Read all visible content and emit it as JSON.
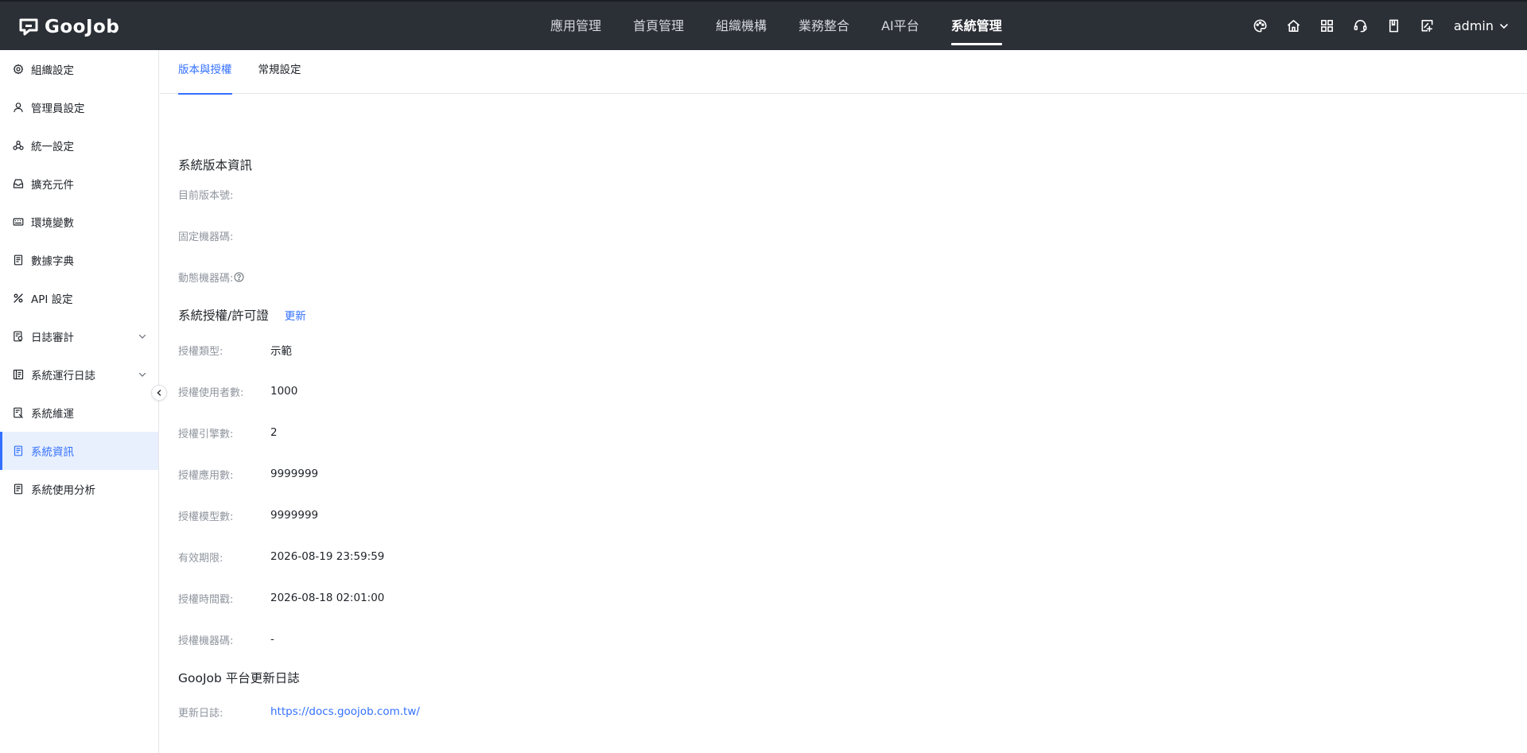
{
  "app": {
    "logo_text": "GooJob",
    "colors": {
      "topbar": "#2b2f36",
      "accent": "#3370ff",
      "active_bg": "#e8f0fe"
    }
  },
  "topnav": {
    "items": [
      {
        "label": "應用管理"
      },
      {
        "label": "首頁管理"
      },
      {
        "label": "組織機構"
      },
      {
        "label": "業務整合"
      },
      {
        "label": "AI平台"
      },
      {
        "label": "系統管理",
        "active": true
      }
    ],
    "icons": [
      "palette-icon",
      "home-icon",
      "grid-icon",
      "headset-icon",
      "book-icon",
      "export-icon"
    ],
    "user": "admin"
  },
  "sidebar": {
    "items": [
      {
        "label": "組織設定",
        "icon": "gear-icon"
      },
      {
        "label": "管理員設定",
        "icon": "user-icon"
      },
      {
        "label": "統一設定",
        "icon": "cluster-icon"
      },
      {
        "label": "擴充元件",
        "icon": "inbox-icon"
      },
      {
        "label": "環境變數",
        "icon": "keyboard-icon"
      },
      {
        "label": "數據字典",
        "icon": "document-icon"
      },
      {
        "label": "API 設定",
        "icon": "api-icon"
      },
      {
        "label": "日誌審計",
        "icon": "audit-icon",
        "expandable": true
      },
      {
        "label": "系統運行日誌",
        "icon": "log-icon",
        "expandable": true
      },
      {
        "label": "系統維運",
        "icon": "maintenance-icon"
      },
      {
        "label": "系統資訊",
        "icon": "info-doc-icon",
        "active": true
      },
      {
        "label": "系統使用分析",
        "icon": "analysis-icon"
      }
    ]
  },
  "tabs": [
    {
      "label": "版本與授權",
      "active": true
    },
    {
      "label": "常規設定"
    }
  ],
  "version_section": {
    "title": "系統版本資訊",
    "rows": [
      {
        "label": "目前版本號:",
        "value": ""
      },
      {
        "label": "固定機器碼:",
        "value": ""
      },
      {
        "label": "動態機器碼:",
        "value": ""
      }
    ]
  },
  "license_section": {
    "title": "系統授權/許可證",
    "action": "更新",
    "rows": [
      {
        "label": "授權類型:",
        "value": "示範"
      },
      {
        "label": "授權使用者數:",
        "value": "1000"
      },
      {
        "label": "授權引擎數:",
        "value": "2"
      },
      {
        "label": "授權應用數:",
        "value": "9999999"
      },
      {
        "label": "授權模型數:",
        "value": "9999999"
      },
      {
        "label": "有效期限:",
        "value": "2026-08-19 23:59:59"
      },
      {
        "label": "授權時間戳:",
        "value": "2026-08-18 02:01:00"
      },
      {
        "label": "授權機器碼:",
        "value": "-"
      }
    ]
  },
  "changelog_section": {
    "title": "GooJob 平台更新日誌",
    "label": "更新日誌:",
    "link": "https://docs.goojob.com.tw/"
  }
}
